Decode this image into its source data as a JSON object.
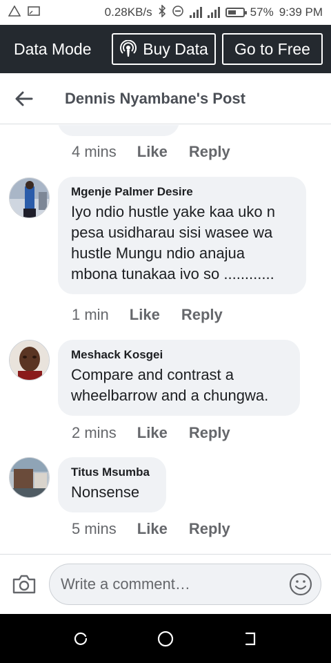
{
  "status_bar": {
    "speed": "0.28KB/s",
    "battery": "57%",
    "battery_level": 0.57,
    "time": "9:39 PM",
    "icons": [
      "warning-icon",
      "cast-icon",
      "bluetooth-icon",
      "do-not-disturb-icon",
      "signal-icon",
      "signal-icon",
      "battery-icon"
    ]
  },
  "data_bar": {
    "title": "Data Mode",
    "buy_label": "Buy Data",
    "free_label": "Go to Free",
    "bg_color": "#24292f"
  },
  "header": {
    "title": "Dennis Nyambane's Post"
  },
  "previous_comment": {
    "time": "4 mins",
    "like": "Like",
    "reply": "Reply"
  },
  "comments": [
    {
      "name": "Mgenje Palmer Desire",
      "lines": [
        "Iyo ndio hustle yake kaa uko n",
        "pesa usidharau sisi wasee wa",
        "hustle Mungu ndio anajua",
        "mbona tunakaa ivo so ............"
      ],
      "time": "1 min",
      "like": "Like",
      "reply": "Reply"
    },
    {
      "name": "Meshack Kosgei",
      "lines": [
        "Compare and contrast a",
        "wheelbarrow and a chungwa."
      ],
      "time": "2 mins",
      "like": "Like",
      "reply": "Reply"
    },
    {
      "name": "Titus Msumba",
      "lines": [
        "Nonsense"
      ],
      "time": "5 mins",
      "like": "Like",
      "reply": "Reply"
    }
  ],
  "composer": {
    "placeholder": "Write a comment…"
  },
  "colors": {
    "bubble": "#f0f2f5",
    "meta_text": "#65676b",
    "title_text": "#4b4f56"
  }
}
